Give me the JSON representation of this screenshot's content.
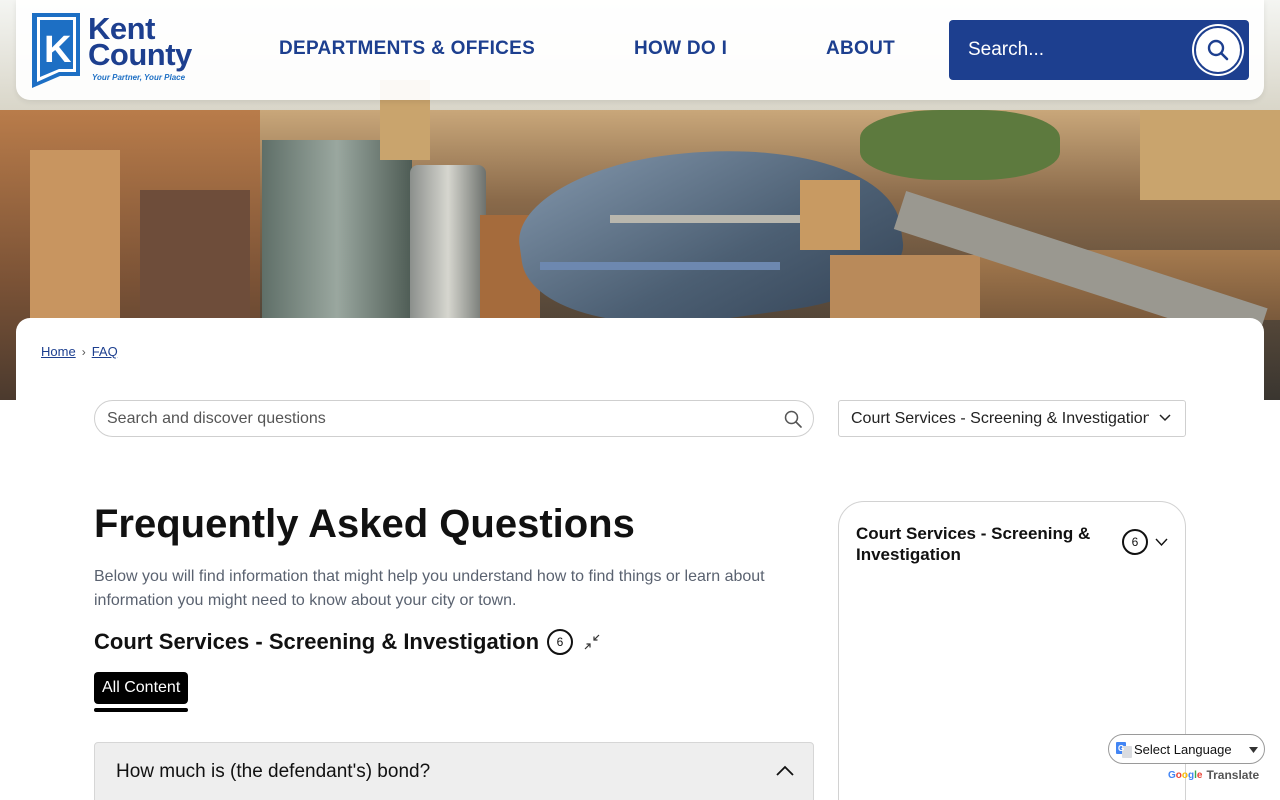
{
  "header": {
    "logo": {
      "name_line1": "Kent",
      "name_line2": "County",
      "tagline": "Your Partner, Your Place",
      "mark_letter": "K"
    },
    "nav": [
      {
        "label": "DEPARTMENTS & OFFICES"
      },
      {
        "label": "HOW DO I"
      },
      {
        "label": "ABOUT"
      }
    ],
    "search": {
      "placeholder": "Search...",
      "icon": "search-icon"
    }
  },
  "hero": {
    "image": "aerial photo of downtown Grand Rapids with river and bridges"
  },
  "breadcrumb": [
    {
      "label": "Home"
    },
    {
      "label": "FAQ"
    }
  ],
  "faq_search": {
    "placeholder": "Search and discover questions",
    "icon": "search-icon"
  },
  "category_select": {
    "selected": "Court Services - Screening & Investigation",
    "icon": "chevron-down-icon"
  },
  "main": {
    "title": "Frequently Asked Questions",
    "intro": "Below you will find information that might help you understand how to find things or learn about information you might need to know about your city or town.",
    "section": {
      "title": "Court Services - Screening & Investigation",
      "count": "6",
      "collapse_icon": "collapse-arrows-icon"
    },
    "tabs": [
      {
        "label": "All Content",
        "active": true
      }
    ],
    "questions": [
      {
        "text": "How much is (the defendant's) bond?",
        "expanded": true
      }
    ]
  },
  "side_panel": {
    "title": "Court Services - Screening & Investigation",
    "count": "6"
  },
  "translate": {
    "select_label": "Select Language",
    "powered_by_brand": "Google",
    "powered_by_word": "Translate"
  },
  "colors": {
    "brand_blue": "#1d3f8f",
    "link_blue": "#1d3f8f",
    "accent_light_blue": "#1d6fc4",
    "text_dark": "#111111",
    "text_muted": "#5a6270",
    "tab_active_bg": "#000000",
    "question_bg": "#eeeeee"
  }
}
